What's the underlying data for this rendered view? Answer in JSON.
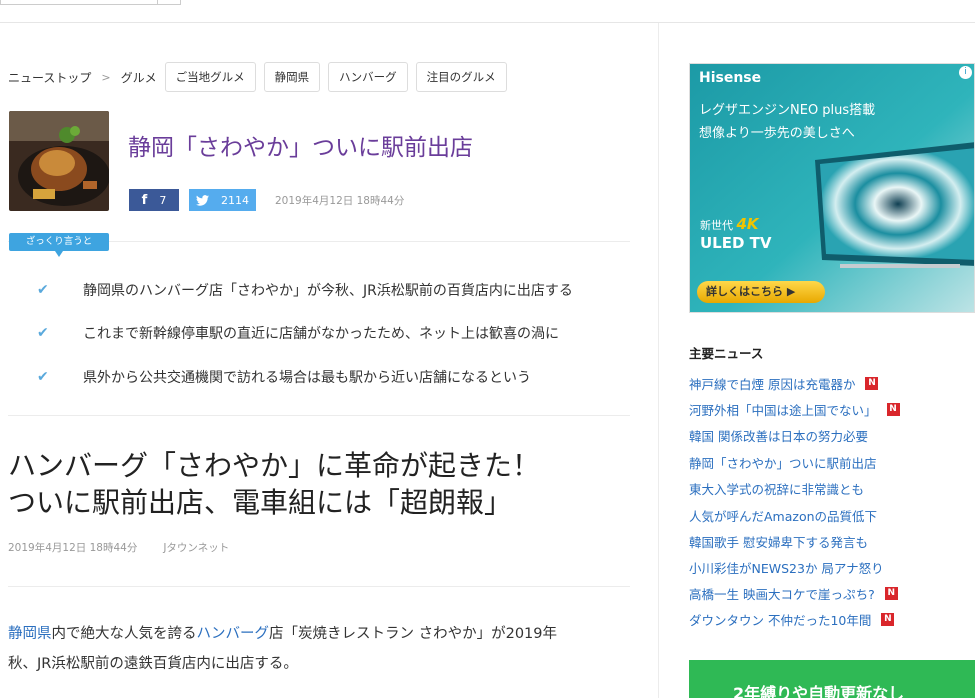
{
  "breadcrumb": {
    "home": "ニューストップ",
    "separator": ">",
    "category": "グルメ"
  },
  "tags": [
    "ご当地グルメ",
    "静岡県",
    "ハンバーグ",
    "注目のグルメ"
  ],
  "article": {
    "headline": "静岡「さわやか」ついに駅前出店",
    "share": {
      "facebook_count": "7",
      "twitter_count": "2114"
    },
    "datetime": "2019年4月12日 18時44分",
    "summary_label": "ざっくり言うと",
    "summary": [
      "静岡県のハンバーグ店「さわやか」が今秋、JR浜松駅前の百貨店内に出店する",
      "これまで新幹線停車駅の直近に店舗がなかったため、ネット上は歓喜の渦に",
      "県外から公共交通機関で訪れる場合は最も駅から近い店舗になるという"
    ],
    "title_line1": "ハンバーグ「さわやか」に革命が起きた！",
    "title_line2": "ついに駅前出店、電車組には「超朗報」",
    "meta_date": "2019年4月12日 18時44分",
    "source": "Jタウンネット",
    "body": {
      "link1": "静岡県",
      "text1": "内で絶大な人気を誇る",
      "link2": "ハンバーグ",
      "text2": "店「炭焼きレストラン さわやか」が2019年",
      "line2": "秋、JR浜松駅前の遠鉄百貨店内に出店する。"
    }
  },
  "ad": {
    "brand": "Hisense",
    "line1": "レグザエンジンNEO plus搭載",
    "line2": "想像より一歩先の美しさへ",
    "new_label": "新世代",
    "four_k": "4K",
    "uled": "ULED TV",
    "cta": "詳しくはこちら ▶",
    "info": "i"
  },
  "sidebar": {
    "news_heading": "主要ニュース",
    "news_badge": "N",
    "news": [
      {
        "title": "神戸線で白煙 原因は充電器か",
        "badge": true
      },
      {
        "title": "河野外相「中国は途上国でない」",
        "badge": true
      },
      {
        "title": "韓国 関係改善は日本の努力必要",
        "badge": false
      },
      {
        "title": "静岡「さわやか」ついに駅前出店",
        "badge": false
      },
      {
        "title": "東大入学式の祝辞に非常識とも",
        "badge": false
      },
      {
        "title": "人気が呼んだAmazonの品質低下",
        "badge": false
      },
      {
        "title": "韓国歌手 慰安婦卑下する発言も",
        "badge": false
      },
      {
        "title": "小川彩佳がNEWS23か 局アナ怒り",
        "badge": false
      },
      {
        "title": "高橋一生 映画大コケで崖っぷち?",
        "badge": true
      },
      {
        "title": "ダウンタウン 不仲だった10年間",
        "badge": true
      }
    ],
    "green_banner": "2年縛りや自動更新なし"
  },
  "colors": {
    "headline": "#6a3d9a",
    "link": "#2b6fbf",
    "summary_tab": "#3ea4e0",
    "badge": "#d9262b",
    "facebook": "#3b5998",
    "twitter": "#55acee"
  }
}
